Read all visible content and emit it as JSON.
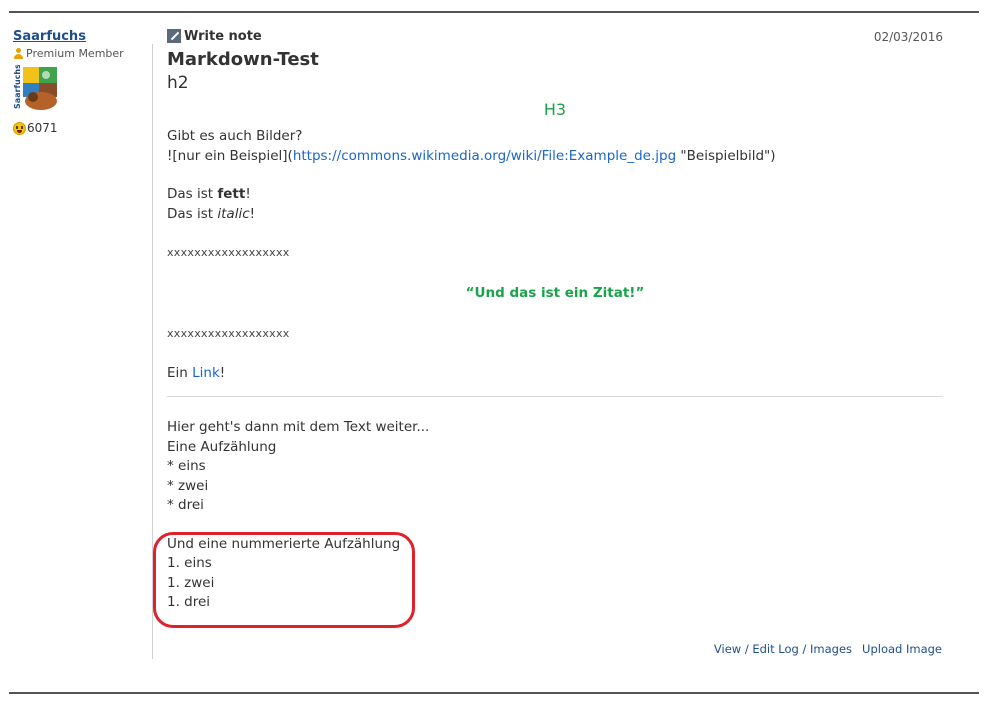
{
  "user": {
    "name": "Saarfuchs",
    "rank": "Premium Member",
    "finds": "6071",
    "avatar_text": "Saarfuchs"
  },
  "log": {
    "type": "Write note",
    "date": "02/03/2016",
    "h1": "Markdown-Test",
    "h2": "h2",
    "h3": "H3",
    "bilder_question": "Gibt es auch Bilder?",
    "image_prefix": "![nur ein Beispiel](",
    "image_url": "https://commons.wikimedia.org/wiki/File:Example_de.jpg",
    "image_suffix": " \"Beispielbild\")",
    "fett_prefix": "Das ist ",
    "fett_word": "fett",
    "fett_suffix": "!",
    "italic_prefix": "Das ist ",
    "italic_word": "italic",
    "italic_suffix": "!",
    "xline1": "xxxxxxxxxxxxxxxxxx",
    "quote": "“Und das ist ein Zitat!”",
    "xline2": "xxxxxxxxxxxxxxxxxx",
    "link_prefix": "Ein ",
    "link_text": "Link",
    "link_suffix": "!",
    "text_continue": "Hier geht's dann mit dem Text weiter...",
    "list_heading": "Eine Aufzählung",
    "list_items": [
      "* eins",
      "* zwei",
      "* drei"
    ],
    "numbered_heading": "Und eine nummerierte Aufzählung",
    "numbered_items": [
      "1. eins",
      "1. zwei",
      "1. drei"
    ]
  },
  "footer": {
    "view_edit": "View / Edit Log / Images",
    "upload": "Upload Image"
  },
  "colors": {
    "heading_green": "#1aa34a",
    "link_blue": "#1a66c9",
    "highlight_red": "#e0202a"
  }
}
